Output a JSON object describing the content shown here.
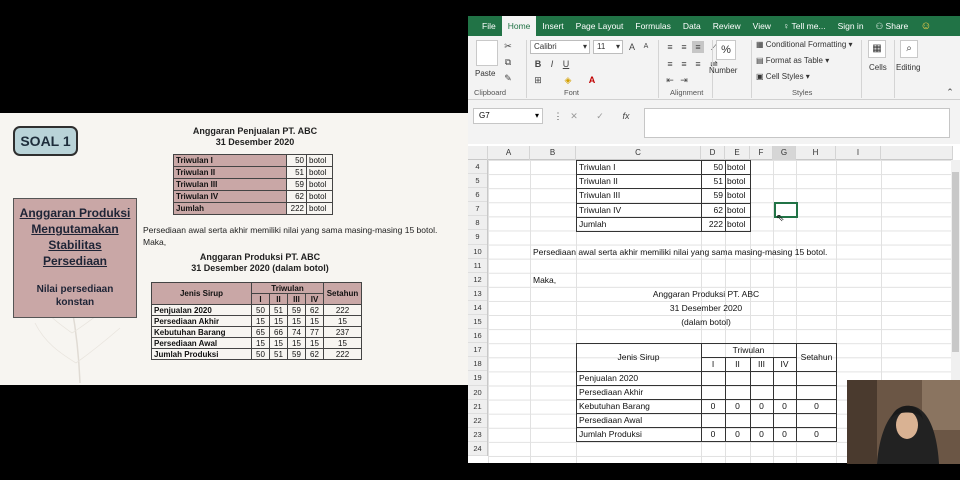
{
  "slide": {
    "soal_label": "SOAL 1",
    "box_title_lines": [
      "Anggaran Produksi",
      "Mengutamakan",
      "Stabilitas",
      "Persediaan"
    ],
    "box_subtitle_lines": [
      "Nilai persediaan",
      "konstan"
    ],
    "sales_title": "Anggaran Penjualan PT. ABC",
    "sales_date": "31 Desember 2020",
    "sales_rows": [
      {
        "label": "Triwulan I",
        "value": "50",
        "unit": "botol"
      },
      {
        "label": "Triwulan II",
        "value": "51",
        "unit": "botol"
      },
      {
        "label": "Triwulan III",
        "value": "59",
        "unit": "botol"
      },
      {
        "label": "Triwulan IV",
        "value": "62",
        "unit": "botol"
      },
      {
        "label": "Jumlah",
        "value": "222",
        "unit": "botol"
      }
    ],
    "note": "Persediaan awal serta akhir memiliki nilai yang sama masing-masing 15 botol.",
    "maka": "Maka,",
    "prod_title": "Anggaran Produksi PT. ABC",
    "prod_date": "31 Desember 2020 (dalam botol)",
    "prod_headers": {
      "jenis": "Jenis Sirup",
      "triwulan": "Triwulan",
      "q": [
        "I",
        "II",
        "III",
        "IV"
      ],
      "setahun": "Setahun"
    },
    "prod_rows": [
      {
        "name": "Penjualan 2020",
        "v": [
          "50",
          "51",
          "59",
          "62",
          "222"
        ]
      },
      {
        "name": "Persediaan Akhir",
        "v": [
          "15",
          "15",
          "15",
          "15",
          "15"
        ]
      },
      {
        "name": "Kebutuhan Barang",
        "v": [
          "65",
          "66",
          "74",
          "77",
          "237"
        ]
      },
      {
        "name": "Persediaan Awal",
        "v": [
          "15",
          "15",
          "15",
          "15",
          "15"
        ]
      },
      {
        "name": "Jumlah Produksi",
        "v": [
          "50",
          "51",
          "59",
          "62",
          "222"
        ]
      }
    ]
  },
  "excel": {
    "tabs": [
      "File",
      "Home",
      "Insert",
      "Page Layout",
      "Formulas",
      "Data",
      "Review",
      "View",
      "Tell me...",
      "Sign in",
      "Share"
    ],
    "font_name": "Calibri",
    "font_size": "11",
    "ribbon": {
      "paste": "Paste",
      "number": "Number",
      "cond_format": "Conditional Formatting",
      "format_table": "Format as Table",
      "cell_styles": "Cell Styles",
      "cells": "Cells",
      "editing": "Editing",
      "groups": [
        "Clipboard",
        "Font",
        "Alignment",
        "Styles"
      ]
    },
    "name_box": "G7",
    "columns": [
      "A",
      "B",
      "C",
      "D",
      "E",
      "F",
      "G",
      "H",
      "I"
    ],
    "rows": [
      "4",
      "5",
      "6",
      "7",
      "8",
      "9",
      "10",
      "11",
      "12",
      "13",
      "14",
      "15",
      "16",
      "17",
      "18",
      "19",
      "20",
      "21",
      "22",
      "23",
      "24"
    ],
    "top_table": [
      {
        "label": "Triwulan I",
        "value": "50",
        "unit": "botol"
      },
      {
        "label": "Triwulan II",
        "value": "51",
        "unit": "botol"
      },
      {
        "label": "Triwulan III",
        "value": "59",
        "unit": "botol"
      },
      {
        "label": "Triwulan IV",
        "value": "62",
        "unit": "botol"
      },
      {
        "label": "Jumlah",
        "value": "222",
        "unit": "botol"
      }
    ],
    "note": "Persediaan awal serta akhir memiliki nilai yang sama masing-masing 15 botol.",
    "maka": "Maka,",
    "title1": "Anggaran Produksi PT. ABC",
    "title2": "31 Desember 2020",
    "title3": "(dalam botol)",
    "hdr_jenis": "Jenis Sirup",
    "hdr_triwulan": "Triwulan",
    "hdr_q": [
      "I",
      "II",
      "III",
      "IV"
    ],
    "hdr_setahun": "Setahun",
    "prod_rows": [
      {
        "name": "Penjualan 2020",
        "v": [
          "",
          "",
          "",
          "",
          ""
        ]
      },
      {
        "name": "Persediaan Akhir",
        "v": [
          "",
          "",
          "",
          "",
          ""
        ]
      },
      {
        "name": "Kebutuhan Barang",
        "v": [
          "0",
          "0",
          "0",
          "0",
          "0"
        ]
      },
      {
        "name": "Persediaan Awal",
        "v": [
          "",
          "",
          "",
          "",
          ""
        ]
      },
      {
        "name": "Jumlah Produksi",
        "v": [
          "0",
          "0",
          "0",
          "0",
          "0"
        ]
      }
    ]
  },
  "colors": {
    "excel_green": "#217346",
    "slide_pink": "#c9a7a6",
    "soal_teal": "#b9d3d8"
  }
}
